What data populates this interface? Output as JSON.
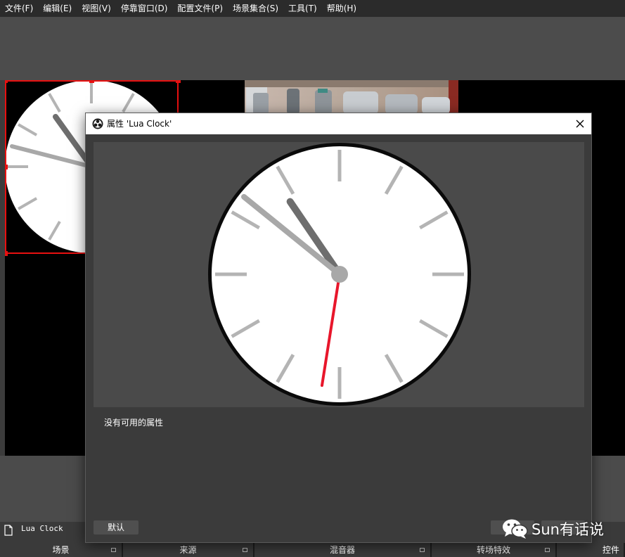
{
  "menubar": {
    "items": [
      "文件(F)",
      "编辑(E)",
      "视图(V)",
      "停靠窗口(D)",
      "配置文件(P)",
      "场景集合(S)",
      "工具(T)",
      "帮助(H)"
    ]
  },
  "preview": {
    "webcam_source": "camera-feed"
  },
  "sources": {
    "item_name": "Lua Clock"
  },
  "docks": {
    "tabs": [
      "场景",
      "来源",
      "混音器",
      "转场特效",
      "控件"
    ]
  },
  "dialog": {
    "title": "属性 'Lua Clock'",
    "no_properties_text": "没有可用的属性",
    "defaults_label": "默认",
    "ok_label": "",
    "cancel_label": "",
    "clock_time": {
      "hour": 10,
      "minute": 51.5,
      "second": 31.5
    }
  },
  "watermark": {
    "text": "Sun有话说"
  },
  "colors": {
    "selection": "#e81010",
    "second_hand": "#e8162b",
    "hour_hand": "#6e6e6e",
    "minute_hand": "#a8a8a8",
    "tick": "#b4b4b4",
    "clock_face": "#ffffff",
    "clock_rim": "#0a0a0a"
  }
}
